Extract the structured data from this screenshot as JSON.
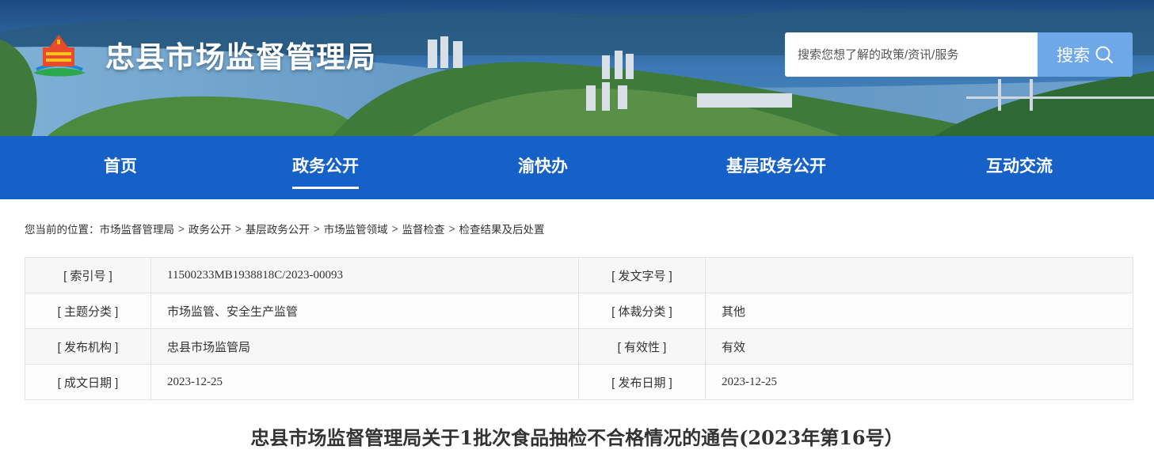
{
  "header": {
    "site_title": "忠县市场监督管理局",
    "search_placeholder": "搜索您想了解的政策/资讯/服务",
    "search_button": "搜索"
  },
  "nav": {
    "items": [
      {
        "label": "首页",
        "active": false
      },
      {
        "label": "政务公开",
        "active": true
      },
      {
        "label": "渝快办",
        "active": false
      },
      {
        "label": "基层政务公开",
        "active": false
      },
      {
        "label": "互动交流",
        "active": false
      }
    ]
  },
  "breadcrumb": {
    "prefix": "您当前的位置：",
    "items": [
      "市场监督管理局",
      "政务公开",
      "基层政务公开",
      "市场监管领域",
      "监督检查",
      "检查结果及后处置"
    ],
    "separator": ">"
  },
  "meta": {
    "rows": [
      {
        "l1": "[ 索引号 ]",
        "v1": "11500233MB1938818C/2023-00093",
        "l2": "[ 发文字号 ]",
        "v2": ""
      },
      {
        "l1": "[ 主题分类 ]",
        "v1": "市场监管、安全生产监管",
        "l2": "[ 体裁分类 ]",
        "v2": "其他"
      },
      {
        "l1": "[ 发布机构 ]",
        "v1": "忠县市场监管局",
        "l2": "[ 有效性 ]",
        "v2": "有效"
      },
      {
        "l1": "[ 成文日期 ]",
        "v1": "2023-12-25",
        "l2": "[ 发布日期 ]",
        "v2": "2023-12-25"
      }
    ]
  },
  "article": {
    "title": "忠县市场监督管理局关于1批次食品抽检不合格情况的通告(2023年第16号）"
  },
  "colors": {
    "nav_bg": "#1561c7",
    "search_button_bg": "#6fa8e8",
    "banner_sky": "#2d6aa8"
  },
  "icons": {
    "logo": "government-emblem-logo",
    "search": "search-icon"
  }
}
